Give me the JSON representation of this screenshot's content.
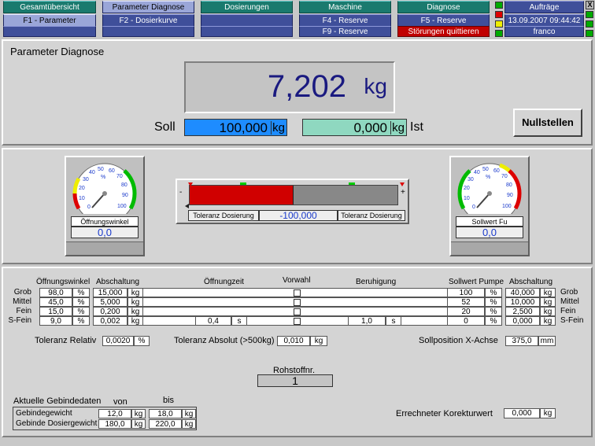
{
  "nav": {
    "row1": [
      "Gesamtübersicht",
      "Parameter Diagnose",
      "Dosierungen",
      "Maschine",
      "Diagnose",
      "Aufträge"
    ],
    "row2": [
      "F1 - Parameter",
      "F2 - Dosierkurve",
      "",
      "F4 - Reserve",
      "F5 - Reserve"
    ],
    "row3": [
      "",
      "",
      "",
      "F9 - Reserve",
      "Störungen quittieren"
    ],
    "datetime": "13.09.2007 09:44:42",
    "user": "franco",
    "close": "X"
  },
  "diag": {
    "title": "Parameter Diagnose",
    "weight": "7,202",
    "weight_unit": "kg",
    "soll_label": "Soll",
    "soll_value": "100,000",
    "soll_unit": "kg",
    "ist_value": "0,000",
    "ist_unit": "kg",
    "ist_label": "Ist",
    "nullstellen": "Nullstellen"
  },
  "gauge_left": {
    "ticks": [
      "0",
      "10",
      "20",
      "%",
      "30",
      "40",
      "50",
      "60",
      "70",
      "80",
      "90",
      "100"
    ],
    "label": "Öffnungswinkel",
    "value": "0,0"
  },
  "gauge_right": {
    "ticks": [
      "0",
      "10",
      "20",
      "%",
      "30",
      "40",
      "50",
      "60",
      "70",
      "80",
      "90",
      "100"
    ],
    "label": "Sollwert Fu",
    "value": "0,0"
  },
  "toleranz_bar": {
    "minus": "-",
    "plus": "+",
    "left_label": "Toleranz Dosierung",
    "value": "-100,000",
    "right_label": "Toleranz Dosierung",
    "fill_fraction": 0.5
  },
  "table": {
    "headers": {
      "oeffnungswinkel": "Öffnungswinkel",
      "abschaltung": "Abschaltung",
      "oeffnungszeit": "Öffnungzeit",
      "vorwahl": "Vorwahl",
      "beruhigung": "Beruhigung",
      "sollwert_pumpe": "Sollwert Pumpe",
      "abschaltung2": "Abschaltung"
    },
    "rows": [
      {
        "name": "Grob",
        "winkel": "98,0",
        "pct": "%",
        "absch": "15,000",
        "kg": "kg",
        "zeit": "",
        "s": "",
        "ber": "",
        "s2": "",
        "pumpe": "100",
        "pct2": "%",
        "absch2": "40,000",
        "kg2": "kg",
        "rname": "Grob"
      },
      {
        "name": "Mittel",
        "winkel": "45,0",
        "pct": "%",
        "absch": "5,000",
        "kg": "kg",
        "zeit": "",
        "s": "",
        "ber": "",
        "s2": "",
        "pumpe": "52",
        "pct2": "%",
        "absch2": "10,000",
        "kg2": "kg",
        "rname": "Mittel"
      },
      {
        "name": "Fein",
        "winkel": "15,0",
        "pct": "%",
        "absch": "0,200",
        "kg": "kg",
        "zeit": "",
        "s": "",
        "ber": "",
        "s2": "",
        "pumpe": "20",
        "pct2": "%",
        "absch2": "2,500",
        "kg2": "kg",
        "rname": "Fein"
      },
      {
        "name": "S-Fein",
        "winkel": "9,0",
        "pct": "%",
        "absch": "0,002",
        "kg": "kg",
        "zeit": "0,4",
        "s": "s",
        "ber": "1,0",
        "s2": "s",
        "pumpe": "0",
        "pct2": "%",
        "absch2": "0,000",
        "kg2": "kg",
        "rname": "S-Fein"
      }
    ]
  },
  "toleranz": {
    "rel_label": "Toleranz Relativ",
    "rel_value": "0,0020",
    "rel_unit": "%",
    "abs_label": "Toleranz Absolut (>500kg)",
    "abs_value": "0,010",
    "abs_unit": "kg",
    "sollpos_label": "Sollposition  X-Achse",
    "sollpos_value": "375,0",
    "sollpos_unit": "mm"
  },
  "rohstoff": {
    "label": "Rohstoffnr.",
    "value": "1"
  },
  "gebinde": {
    "title": "Aktuelle Gebindedaten",
    "von": "von",
    "bis": "bis",
    "rows": [
      {
        "label": "Gebindegewicht",
        "von": "12,0",
        "u1": "kg",
        "bis": "18,0",
        "u2": "kg"
      },
      {
        "label": "Gebinde Dosiergewicht",
        "von": "180,0",
        "u1": "kg",
        "bis": "220,0",
        "u2": "kg"
      }
    ]
  },
  "korrektur": {
    "label": "Errechneter Korekturwert",
    "value": "0,000",
    "unit": "kg"
  },
  "colors": {
    "soll_bg": "#1e8cff",
    "ist_bg": "#8fd8c0",
    "weight_text": "#1a1a80",
    "bar_red": "#d00000",
    "gauge_value": "#1a3acc"
  }
}
